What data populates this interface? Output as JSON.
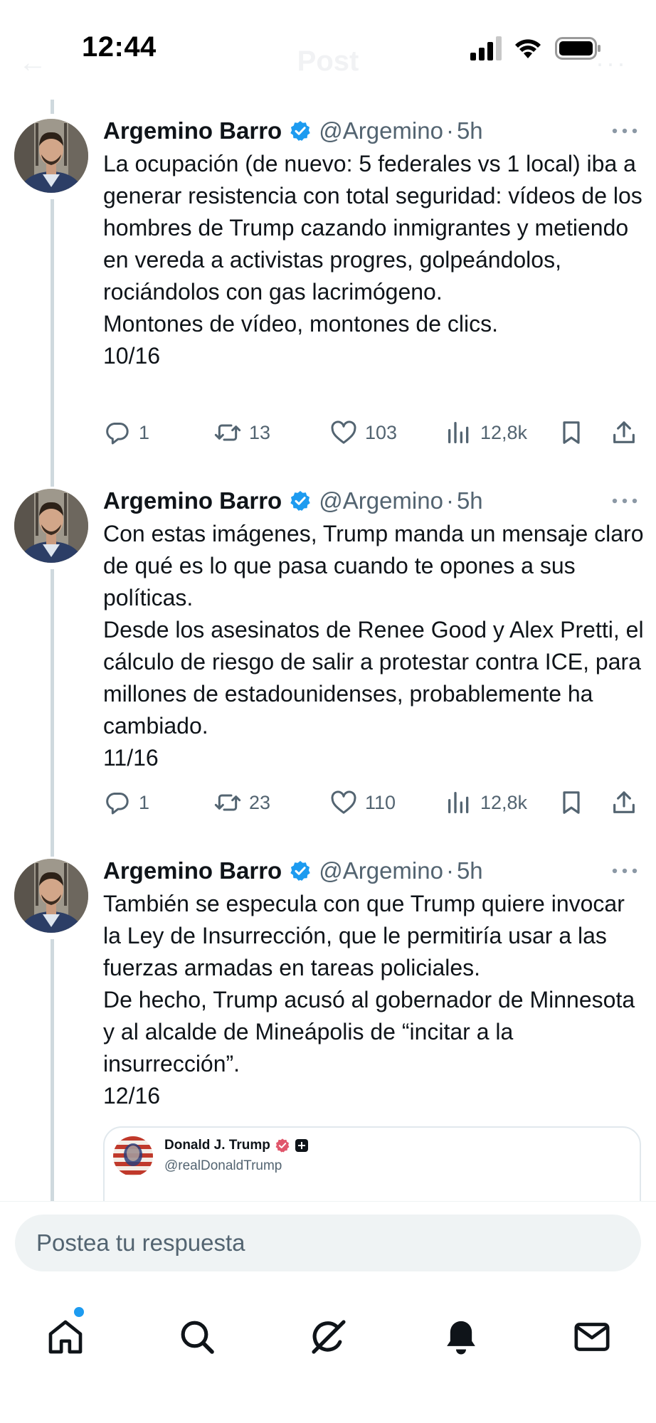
{
  "status_bar": {
    "time": "12:44",
    "signal_icon": "cellular-signal-icon",
    "wifi_icon": "wifi-icon",
    "battery_icon": "battery-icon"
  },
  "header": {
    "back_glyph": "←",
    "title": "Post",
    "more_glyph": "···"
  },
  "colors": {
    "verified_blue": "#1d9bf0",
    "text_primary": "#0f1419",
    "text_secondary": "#536471",
    "thread_line": "#cfd9de"
  },
  "tweets": [
    {
      "author_name": "Argemino Barro",
      "handle": "@Argemino",
      "separator": "·",
      "time": "5h",
      "text": "La ocupación (de nuevo: 5 federales vs 1 local) iba a generar resistencia con total seguridad: vídeos de los hombres de Trump cazando inmigrantes y metiendo en vereda a activistas progres, golpeándolos, rociándolos con gas lacrimógeno.\nMontones de vídeo, montones de clics.\n10/16",
      "replies": "1",
      "retweets": "13",
      "likes": "103",
      "views": "12,8k"
    },
    {
      "author_name": "Argemino Barro",
      "handle": "@Argemino",
      "separator": "·",
      "time": "5h",
      "text": "Con estas imágenes, Trump manda un mensaje claro de qué es lo que pasa cuando te opones a sus políticas.\nDesde los asesinatos de Renee Good y Alex Pretti, el cálculo de riesgo de salir a protestar contra ICE, para millones de estadounidenses, probablemente ha cambiado.\n11/16",
      "replies": "1",
      "retweets": "23",
      "likes": "110",
      "views": "12,8k"
    },
    {
      "author_name": "Argemino Barro",
      "handle": "@Argemino",
      "separator": "·",
      "time": "5h",
      "text": "También se especula con que Trump quiere invocar la Ley de Insurrección, que le permitiría usar a las fuerzas armadas en tareas policiales.\nDe hecho, Trump acusó al gobernador de Minnesota y al alcalde de Mineápolis de “incitar a la insurrección”.\n12/16",
      "quoted": {
        "author_name": "Donald J. Trump",
        "handle": "@realDonaldTrump"
      }
    }
  ],
  "composer": {
    "placeholder": "Postea tu respuesta"
  },
  "bottom_nav": {
    "items": [
      "home-icon",
      "search-icon",
      "grok-icon",
      "notifications-bell-icon",
      "messages-envelope-icon"
    ]
  }
}
